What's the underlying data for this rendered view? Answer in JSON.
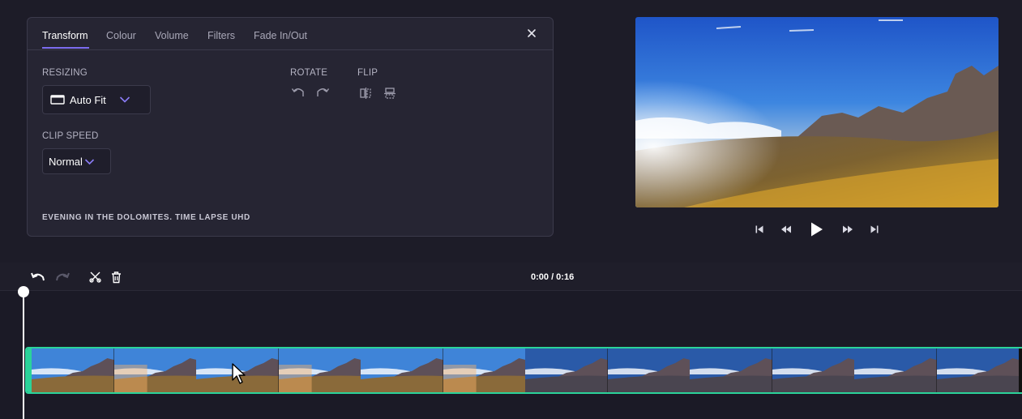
{
  "properties_panel": {
    "tabs": [
      {
        "label": "Transform",
        "active": true
      },
      {
        "label": "Colour",
        "active": false
      },
      {
        "label": "Volume",
        "active": false
      },
      {
        "label": "Filters",
        "active": false
      },
      {
        "label": "Fade In/Out",
        "active": false
      }
    ],
    "close_icon": "close-icon",
    "resizing": {
      "label": "RESIZING",
      "value": "Auto Fit",
      "icon": "aspect-ratio-icon"
    },
    "rotate": {
      "label": "ROTATE",
      "icons": [
        "rotate-left-icon",
        "rotate-right-icon"
      ]
    },
    "flip": {
      "label": "FLIP",
      "icons": [
        "flip-horizontal-icon",
        "flip-vertical-icon"
      ]
    },
    "clip_speed": {
      "label": "CLIP SPEED",
      "value": "Normal"
    },
    "clip_title": "EVENING IN THE DOLOMITES. TIME LAPSE UHD",
    "accent_color": "#7c6cf0"
  },
  "player": {
    "controls": [
      "skip-back-icon",
      "rewind-icon",
      "play-icon",
      "fast-forward-icon",
      "skip-forward-icon"
    ]
  },
  "timeline": {
    "toolbar_icons": [
      "undo-icon",
      "redo-icon",
      "split-icon",
      "delete-icon"
    ],
    "timecode": "0:00 / 0:16",
    "clip_color": "#2bd39a",
    "thumbnail_count": 12
  }
}
